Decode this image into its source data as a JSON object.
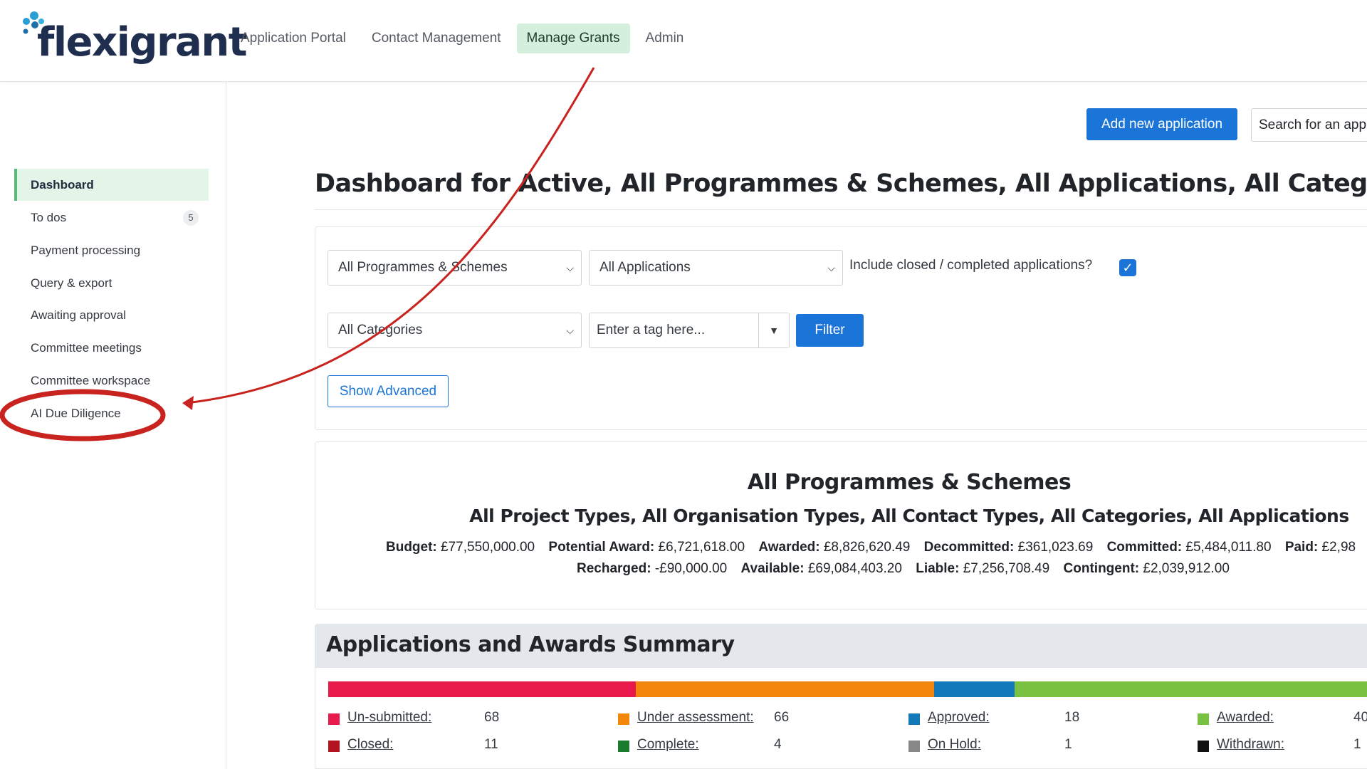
{
  "brand": {
    "name": "flexigrant"
  },
  "nav": [
    "Application Portal",
    "Contact Management",
    "Manage Grants",
    "Admin"
  ],
  "sidebar": {
    "items": [
      {
        "label": "Dashboard"
      },
      {
        "label": "To dos",
        "badge": "5"
      },
      {
        "label": "Payment processing"
      },
      {
        "label": "Query & export"
      },
      {
        "label": "Awaiting approval"
      },
      {
        "label": "Committee meetings"
      },
      {
        "label": "Committee workspace"
      },
      {
        "label": "AI Due Diligence"
      }
    ]
  },
  "toolbar": {
    "add_label": "Add new application",
    "search_text": "Search for an app"
  },
  "page": {
    "title": "Dashboard for Active, All Programmes & Schemes, All Applications, All Categories"
  },
  "filters": {
    "programmes": "All Programmes & Schemes",
    "applications": "All Applications",
    "include_closed_label": "Include closed / completed applications?",
    "categories": "All Categories",
    "tag_placeholder": "Enter a tag here...",
    "filter_label": "Filter",
    "advanced_label": "Show Advanced"
  },
  "summary": {
    "title": "All Programmes & Schemes",
    "subtitle": "All Project Types, All Organisation Types, All Contact Types, All Categories, All Applications",
    "line1": [
      {
        "k": "Budget:",
        "v": "£77,550,000.00"
      },
      {
        "k": "Potential Award:",
        "v": "£6,721,618.00"
      },
      {
        "k": "Awarded:",
        "v": "£8,826,620.49"
      },
      {
        "k": "Decommitted:",
        "v": "£361,023.69"
      },
      {
        "k": "Committed:",
        "v": "£5,484,011.80"
      },
      {
        "k": "Paid:",
        "v": "£2,98"
      }
    ],
    "line2": [
      {
        "k": "Recharged:",
        "v": "-£90,000.00"
      },
      {
        "k": "Available:",
        "v": "£69,084,403.20"
      },
      {
        "k": "Liable:",
        "v": "£7,256,708.49"
      },
      {
        "k": "Contingent:",
        "v": "£2,039,912.00"
      }
    ]
  },
  "aas": {
    "title": "Applications and Awards Summary",
    "segments": [
      {
        "color": "#e8194b",
        "fraction": 0.296
      },
      {
        "color": "#f2870b",
        "fraction": 0.287
      },
      {
        "color": "#127ab8",
        "fraction": 0.078
      },
      {
        "color": "#7ac142",
        "fraction": 0.339
      }
    ],
    "legend": [
      {
        "label": "Un-submitted:",
        "count": "68",
        "color": "#e8194b"
      },
      {
        "label": "Under assessment:",
        "count": "66",
        "color": "#f2870b"
      },
      {
        "label": "Approved:",
        "count": "18",
        "color": "#127ab8"
      },
      {
        "label": "Awarded:",
        "count": "40",
        "color": "#7ac142"
      },
      {
        "label": "Closed:",
        "count": "11",
        "color": "#b3121f"
      },
      {
        "label": "Complete:",
        "count": "4",
        "color": "#1a7a2e"
      },
      {
        "label": "On Hold:",
        "count": "1",
        "color": "#888888"
      },
      {
        "label": "Withdrawn:",
        "count": "1",
        "color": "#111111"
      }
    ]
  },
  "colors": {
    "primary": "#1b74d8",
    "nav_active_bg": "#d4f0dd",
    "annotation": "#c8231e"
  }
}
